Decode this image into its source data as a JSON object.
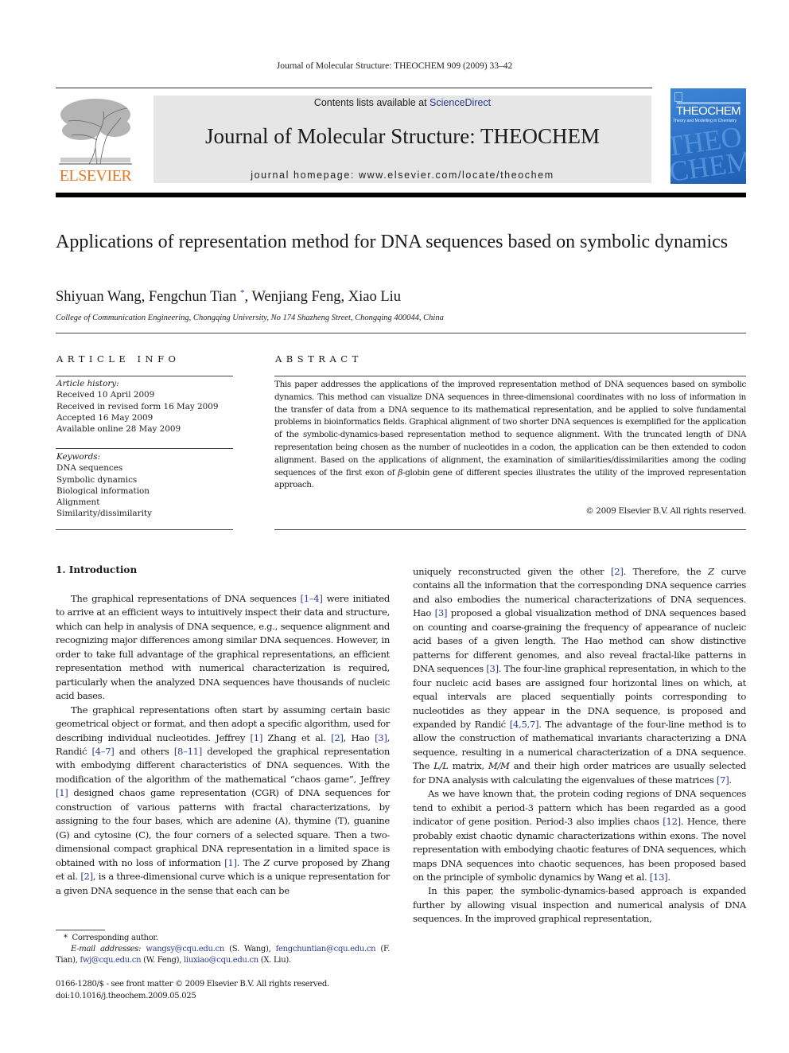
{
  "running_head": "Journal of Molecular Structure: THEOCHEM 909 (2009) 33–42",
  "masthead": {
    "contents_prefix": "Contents lists available at ",
    "contents_link": "ScienceDirect",
    "journal_title": "Journal of Molecular Structure: THEOCHEM",
    "homepage": "journal homepage: www.elsevier.com/locate/theochem"
  },
  "publisher_logo": {
    "wordmark": "ELSEVIER",
    "icon": "tree-icon",
    "color": "#e87722"
  },
  "journal_cover": {
    "title": "THEOCHEM",
    "subtitle": "Theory and Modelling in Chemistry",
    "background_text": "THEO CHEM",
    "color": "#2b6fc4"
  },
  "article": {
    "title": "Applications of representation method for DNA sequences based on symbolic dynamics",
    "authors": [
      {
        "name": "Shiyuan Wang",
        "mark": ""
      },
      {
        "name": "Fengchun Tian",
        "mark": "*"
      },
      {
        "name": "Wenjiang Feng",
        "mark": ""
      },
      {
        "name": "Xiao Liu",
        "mark": ""
      }
    ],
    "affiliation": "College of Communication Engineering, Chongqing University, No 174 Shazheng Street, Chongqing 400044, China"
  },
  "article_info": {
    "heading": "ARTICLE INFO",
    "history_label": "Article history:",
    "history": [
      "Received 10 April 2009",
      "Received in revised form 16 May 2009",
      "Accepted 16 May 2009",
      "Available online 28 May 2009"
    ],
    "keywords_label": "Keywords:",
    "keywords": [
      "DNA sequences",
      "Symbolic dynamics",
      "Biological information",
      "Alignment",
      "Similarity/dissimilarity"
    ]
  },
  "abstract": {
    "heading": "ABSTRACT",
    "text_1": "This paper addresses the applications of the improved representation method of DNA sequences based on symbolic dynamics. This method can visualize DNA sequences in three-dimensional coordinates with no loss of information in the transfer of data from a DNA sequence to its mathematical representation, and be applied to solve fundamental problems in bioinformatics fields. Graphical alignment of two shorter DNA sequences is exemplified for the application of the symbolic-dynamics-based representation method to sequence alignment. With the truncated length of DNA representation being chosen as the number of nucleotides in a codon, the application can be then extended to codon alignment. Based on the applications of alignment, the examination of similarities/dissimilarities among the coding sequences of the first exon of ",
    "beta": "β",
    "text_2": "-globin gene of different species illustrates the utility of the improved representation approach.",
    "copyright": "© 2009 Elsevier B.V. All rights reserved."
  },
  "introduction": {
    "heading": "1. Introduction",
    "p1": [
      {
        "t": "The graphical representations of DNA sequences "
      },
      {
        "ref": "[1–4]"
      },
      {
        "t": " were initiated to arrive at an efficient ways to intuitively inspect their data and structure, which can help in analysis of DNA sequence, e.g., sequence alignment and recognizing major differences among similar DNA sequences. However, in order to take full advantage of the graphical representations, an efficient representation method with numerical characterization is required, particularly when the analyzed DNA sequences have thousands of nucleic acid bases."
      }
    ],
    "p2": [
      {
        "t": "The graphical representations often start by assuming certain basic geometrical object or format, and then adopt a specific algorithm, used for describing individual nucleotides. Jeffrey "
      },
      {
        "ref": "[1]"
      },
      {
        "t": " Zhang et al. "
      },
      {
        "ref": "[2]"
      },
      {
        "t": ", Hao "
      },
      {
        "ref": "[3]"
      },
      {
        "t": ", Randić "
      },
      {
        "ref": "[4–7]"
      },
      {
        "t": " and others "
      },
      {
        "ref": "[8–11]"
      },
      {
        "t": " developed the graphical representation with embodying different characteristics of DNA sequences. With the modification of the algorithm of the mathematical “chaos game”, Jeffrey "
      },
      {
        "ref": "[1]"
      },
      {
        "t": " designed chaos game representation (CGR) of DNA sequences for construction of various patterns with fractal characterizations, by assigning to the four bases, which are adenine (A), thymine (T), guanine (G) and cytosine (C), the four corners of a selected square. Then a two-dimensional compact graphical DNA representation in a limited space is obtained with no loss of information "
      },
      {
        "ref": "[1]"
      },
      {
        "t": ". The "
      },
      {
        "i": "Z"
      },
      {
        "t": " curve proposed by Zhang et al. "
      },
      {
        "ref": "[2]"
      },
      {
        "t": ", is a three-dimensional curve which is a unique representation for a given DNA sequence in the sense that each can be uniquely reconstructed given the other "
      },
      {
        "ref": "[2]"
      },
      {
        "t": ". Therefore, the "
      },
      {
        "i": "Z"
      },
      {
        "t": " curve contains all the information that the corresponding DNA sequence carries and also embodies the numerical characterizations of DNA sequences. Hao "
      },
      {
        "ref": "[3]"
      },
      {
        "t": " proposed a global visualization method of DNA sequences based on counting and coarse-graining the frequency of appearance of nucleic acid bases of a given length. The Hao method can show distinctive patterns for different genomes, and also reveal fractal-like patterns in DNA sequences "
      },
      {
        "ref": "[3]"
      },
      {
        "t": ". The four-line graphical representation, in which to the four nucleic acid bases are assigned four horizontal lines on which, at equal intervals are placed sequentially points corresponding to nucleotides as they appear in the DNA sequence, is proposed and expanded by Randić "
      },
      {
        "ref": "[4,5,7]"
      },
      {
        "t": ". The advantage of the four-line method is to allow the construction of mathematical invariants characterizing a DNA sequence, resulting in a numerical characterization of a DNA sequence. The "
      },
      {
        "i": "L/L"
      },
      {
        "t": " matrix, "
      },
      {
        "i": "M/M"
      },
      {
        "t": " and their high order matrices are usually selected for DNA analysis with calculating the eigenvalues of these matrices "
      },
      {
        "ref": "[7]"
      },
      {
        "t": "."
      }
    ],
    "p3": [
      {
        "t": "As we have known that, the protein coding regions of DNA sequences tend to exhibit a period-3 pattern which has been regarded as a good indicator of gene position. Period-3 also implies chaos "
      },
      {
        "ref": "[12]"
      },
      {
        "t": ". Hence, there probably exist chaotic dynamic characterizations within exons. The novel representation with embodying chaotic features of DNA sequences, which maps DNA sequences into chaotic sequences, has been proposed based on the principle of symbolic dynamics by Wang et al. "
      },
      {
        "ref": "[13]"
      },
      {
        "t": "."
      }
    ],
    "p4": [
      {
        "t": "In this paper, the symbolic-dynamics-based approach is expanded further by allowing visual inspection and numerical analysis of DNA sequences. In the improved graphical representation,"
      }
    ]
  },
  "footnotes": {
    "corresponding_mark": "*",
    "corresponding_text": "Corresponding author.",
    "email_label": "E-mail addresses:",
    "emails": [
      {
        "address": "wangsy@cqu.edu.cn",
        "who": "(S. Wang)"
      },
      {
        "address": "fengchuntian@cqu.edu.cn",
        "who": "(F. Tian)"
      },
      {
        "address": "fwj@cqu.edu.cn",
        "who": "(W. Feng)"
      },
      {
        "address": "liuxiao@cqu.edu.cn",
        "who": "(X. Liu)."
      }
    ]
  },
  "front_matter": {
    "issn_line": "0166-1280/$ - see front matter © 2009 Elsevier B.V. All rights reserved.",
    "doi": "doi:10.1016/j.theochem.2009.05.025"
  }
}
